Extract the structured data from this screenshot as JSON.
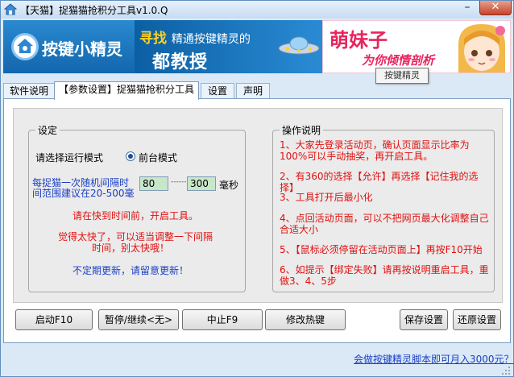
{
  "window": {
    "title": "【天猫】捉猫猫抢积分工具v1.0.Q",
    "minimize_label": "–",
    "close_label": "✕"
  },
  "banner": {
    "logo_text": "按键小精灵",
    "ad1_highlight": "寻找",
    "ad1_sub": "精通按键精灵的",
    "ad1_big": "都教授",
    "ad2_title": "萌妹子",
    "ad2_sub": "为你倾情剖析",
    "tooltip": "按键精灵"
  },
  "tabs": [
    {
      "label": "软件说明"
    },
    {
      "label": "【参数设置】捉猫猫抢积分工具"
    },
    {
      "label": "设置"
    },
    {
      "label": "声明"
    }
  ],
  "settings": {
    "legend": "设定",
    "mode_label": "请选择运行模式",
    "mode_option": "前台模式",
    "interval_line1": "每捉猫一次随机间隔时",
    "interval_line2": "间范围建议在20-500毫",
    "min_value": "80",
    "separator": "------",
    "max_value": "300",
    "unit": "毫秒",
    "notice1": "请在快到时间前，开启工具。",
    "notice2_line1": "觉得太快了，可以适当调整一下间隔",
    "notice2_line2": "时间，别太快哦！",
    "notice3": "不定期更新，请留意更新！"
  },
  "instructions": {
    "legend": "操作说明",
    "items": [
      "1、大家先登录活动页，确认页面显示比率为100%可以手动抽奖，再开启工具。",
      "2、有360的选择【允许】再选择【记住我的选择】",
      "3、工具打开后最小化",
      "4、点回活动页面，可以不把网页最大化调整自己合适大小",
      "5、【鼠标必须停留在活动页面上】再按F10开始",
      "6、如提示【绑定失败】请再按说明重启工具，重做3、4、5步"
    ]
  },
  "buttons": {
    "start": "启动F10",
    "pause": "暂停/继续<无>",
    "stop": "中止F9",
    "hotkey": "修改热键",
    "save": "保存设置",
    "restore": "还原设置"
  },
  "footer_link": "会做按键精灵脚本即可月入3000元？",
  "colors": {
    "instruction_red": "#e01010",
    "info_blue": "#1a3fc4",
    "input_green": "#c8e6c8",
    "banner_blue": "#1d73b7"
  }
}
